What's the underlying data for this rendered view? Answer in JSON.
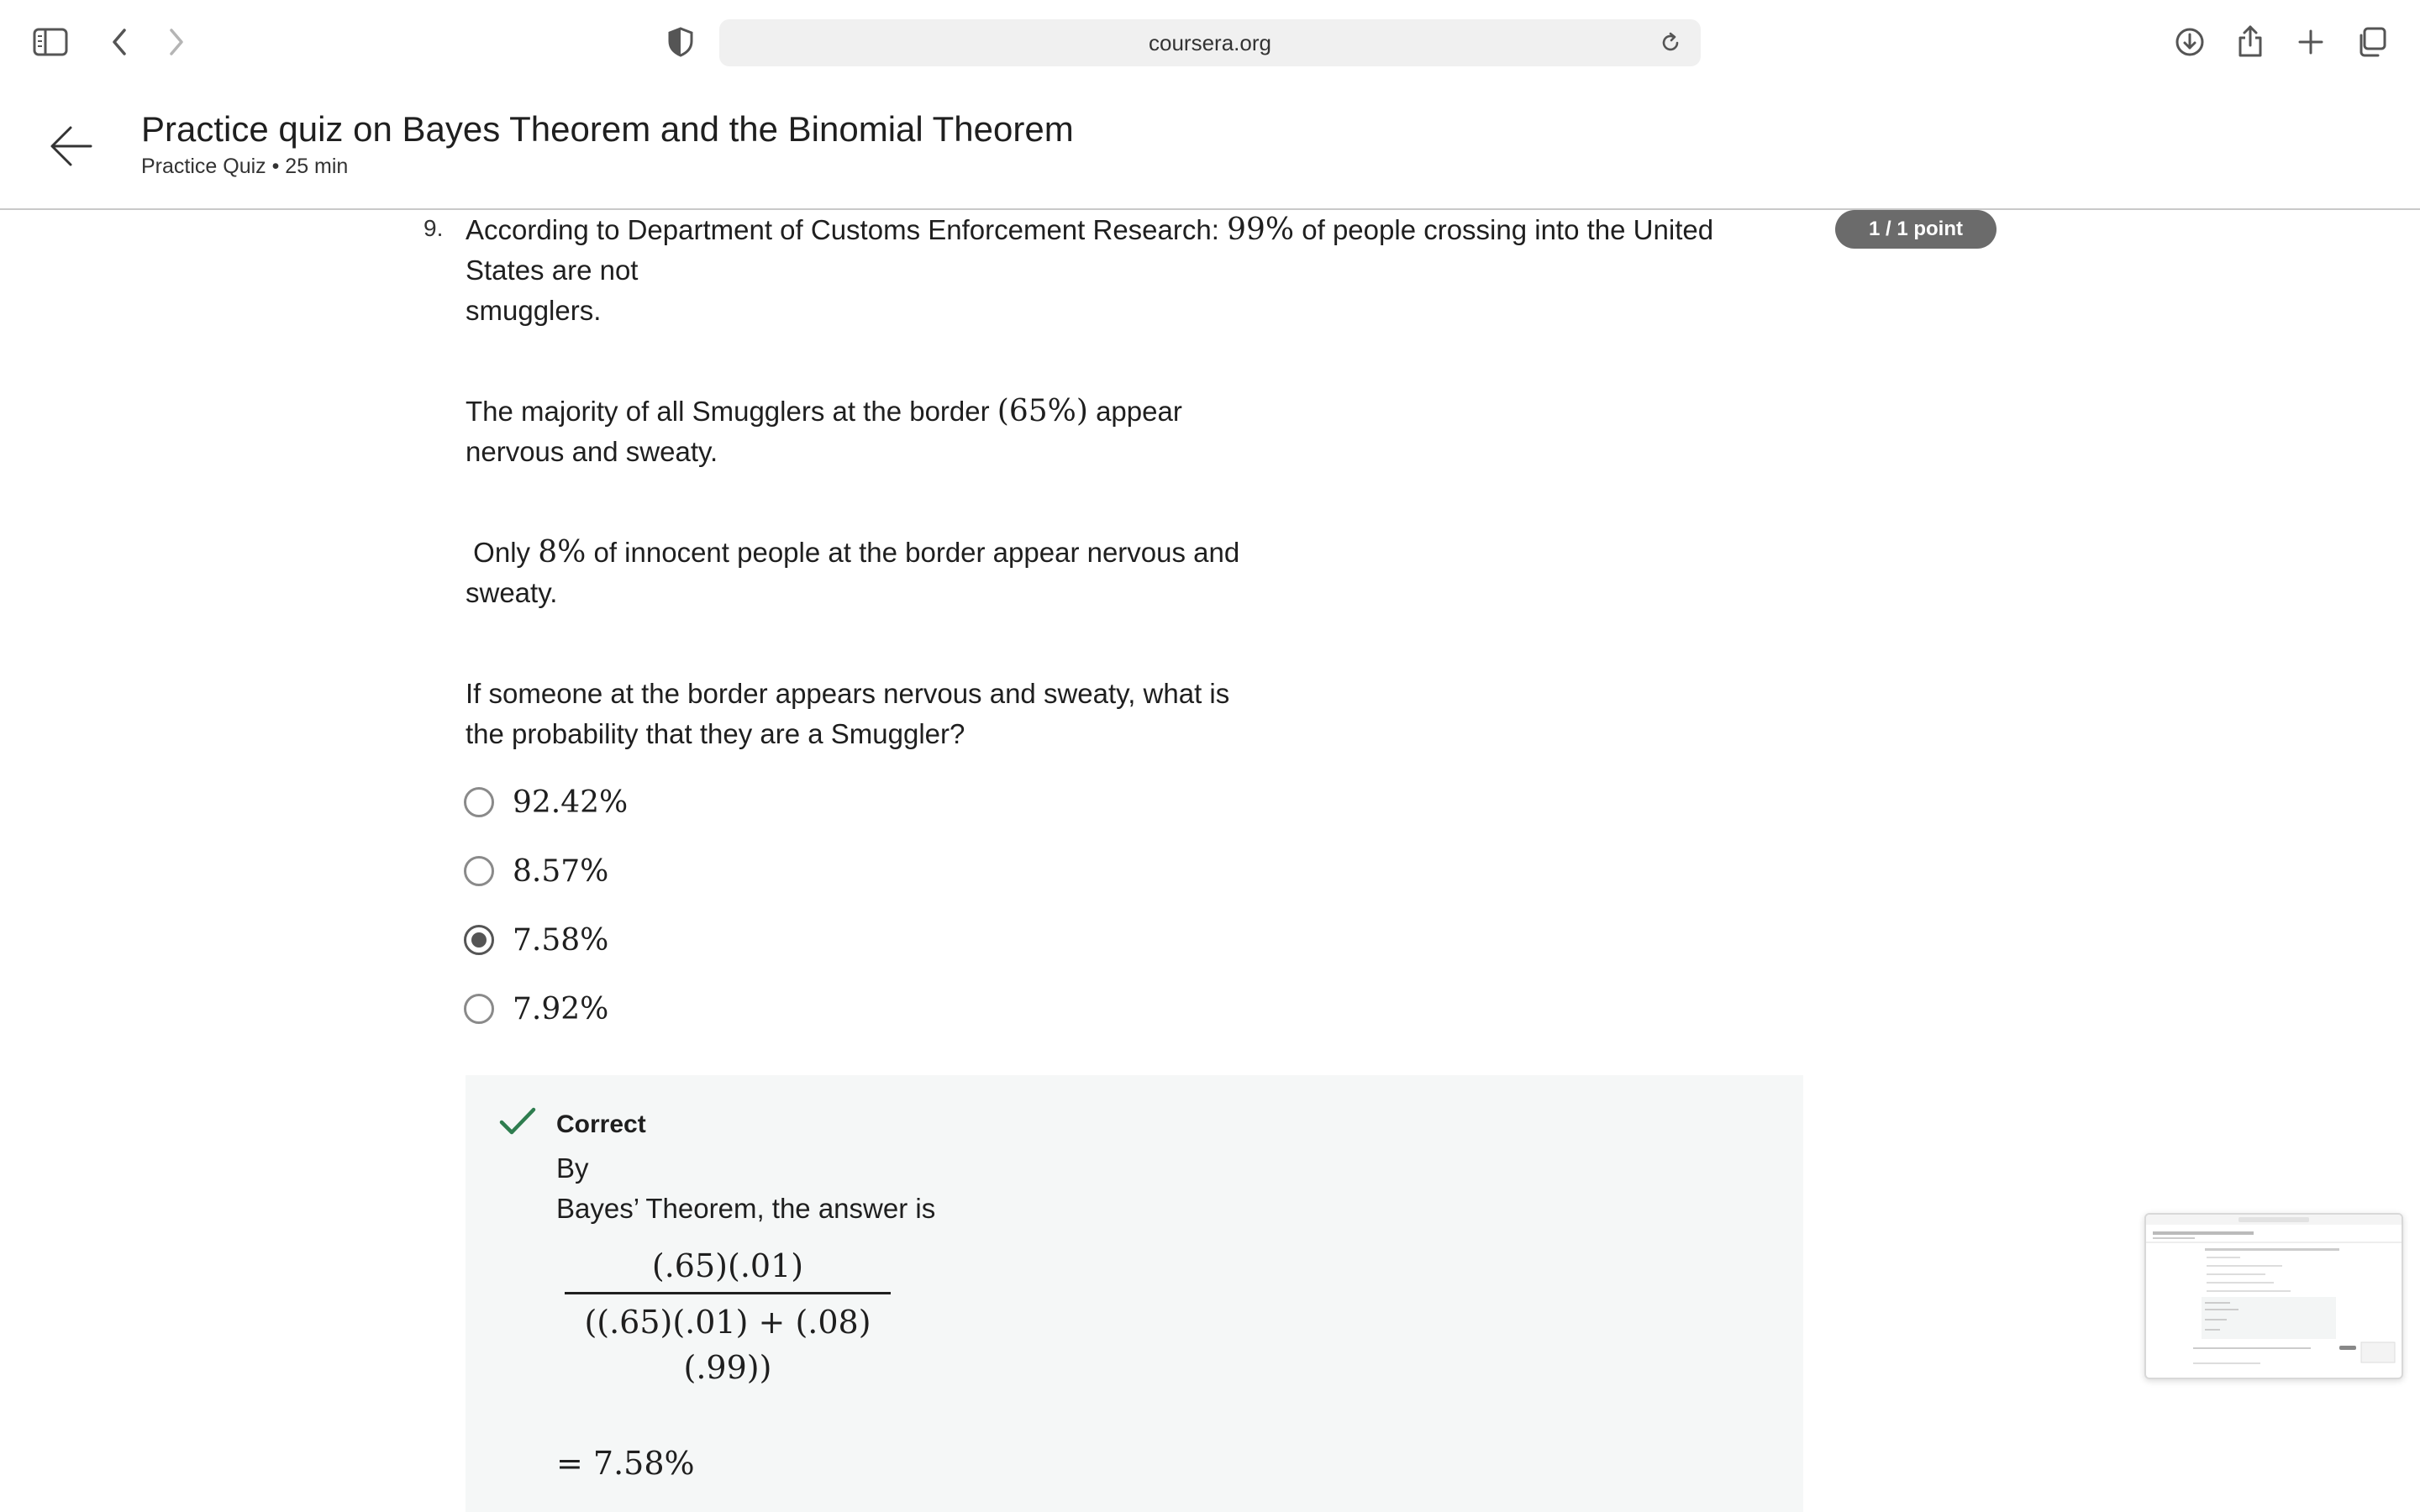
{
  "browser": {
    "url": "coursera.org"
  },
  "header": {
    "title": "Practice quiz on Bayes Theorem and the Binomial Theorem",
    "subtitle": "Practice Quiz • 25 min"
  },
  "question": {
    "number": "9.",
    "score": "1 / 1 point",
    "para1": {
      "a": "According to Department of Customs Enforcement Research: ",
      "math": "99%",
      "b": " of people crossing into the United",
      "line2": "States are not",
      "line3": "smugglers."
    },
    "para2": {
      "a": "The majority of all Smugglers at the border ",
      "math": "(65%)",
      "b": " appear",
      "line2": "nervous and sweaty."
    },
    "para3": {
      "a": " Only ",
      "math": "8%",
      "b": " of innocent people at the border appear nervous and",
      "line2": "sweaty."
    },
    "para4": {
      "line1": "If someone at the border appears nervous and sweaty, what is",
      "line2": "the probability that they are a Smuggler?"
    },
    "options": [
      {
        "label": "92.42%",
        "selected": false
      },
      {
        "label": "8.57%",
        "selected": false
      },
      {
        "label": "7.58%",
        "selected": true
      },
      {
        "label": "7.92%",
        "selected": false
      }
    ]
  },
  "feedback": {
    "status": "Correct",
    "line1": "By",
    "line2": "Bayes’ Theorem, the answer is",
    "numerator": "(.65)(.01)",
    "denominator": "((.65)(.01) + (.08)(.99))",
    "result": "= 7.58%"
  }
}
